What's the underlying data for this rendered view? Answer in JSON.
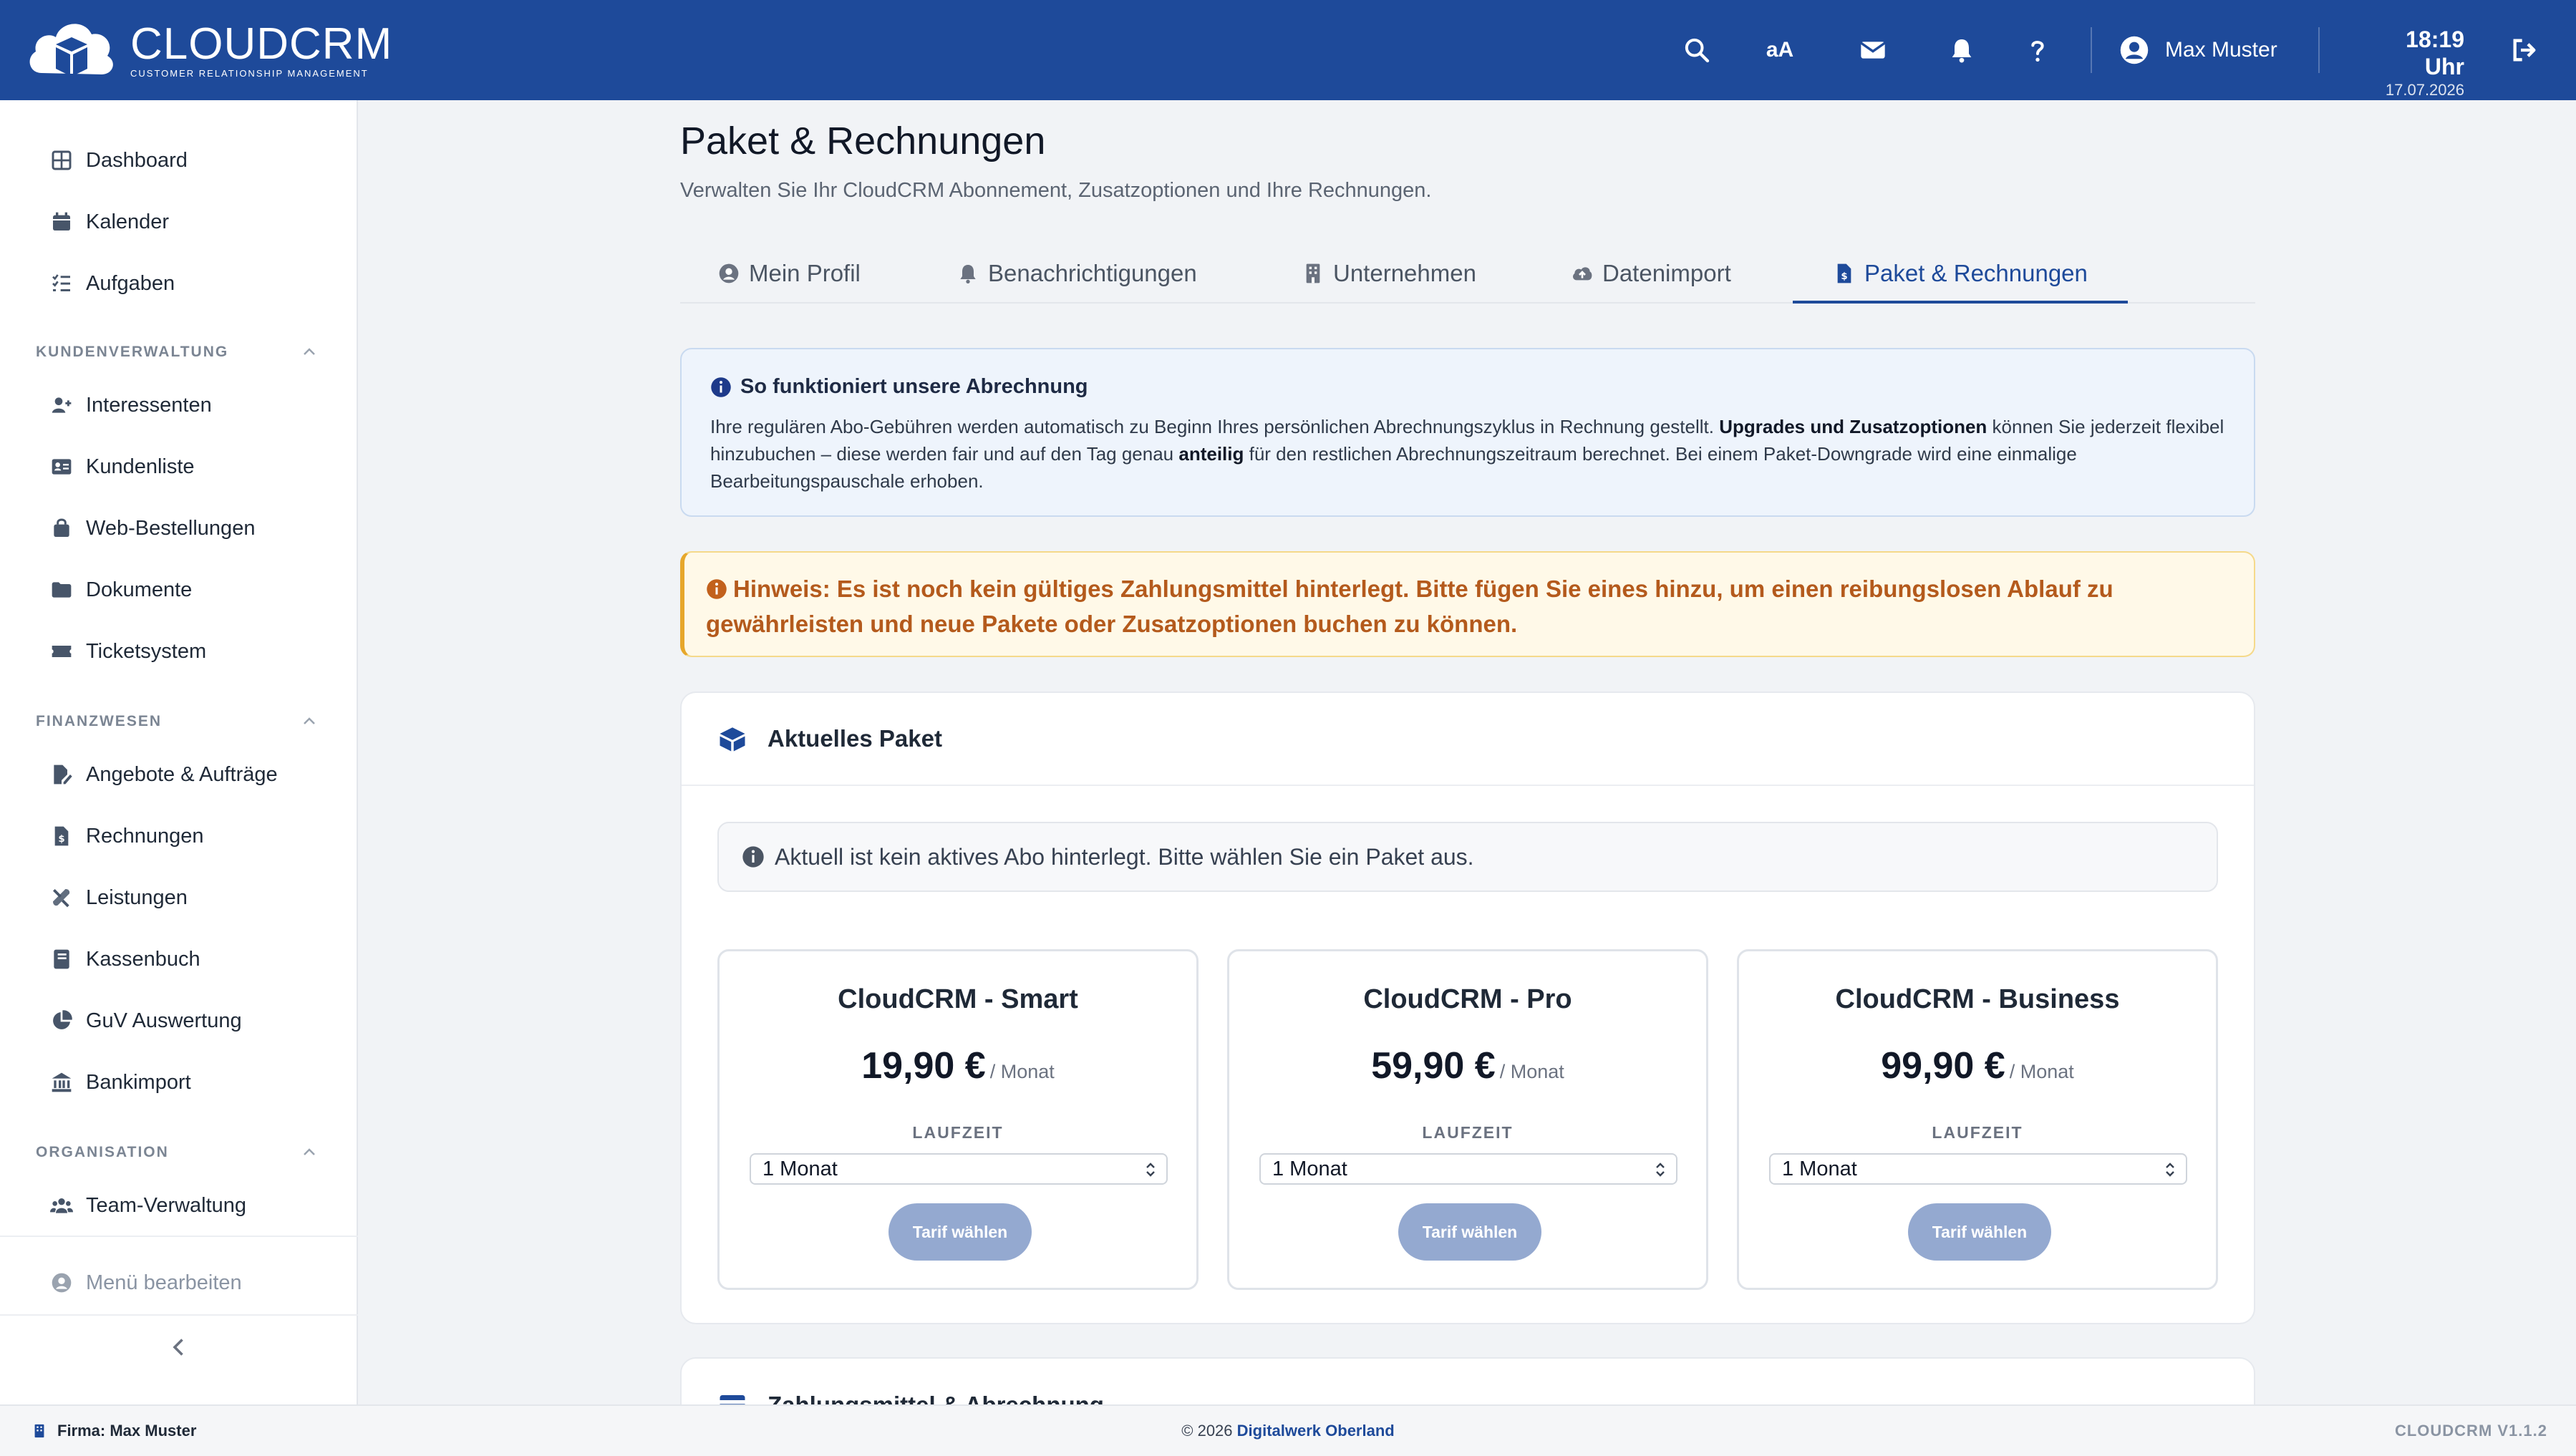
{
  "header": {
    "logo_title": "CLOUDCRM",
    "logo_subtitle": "CUSTOMER RELATIONSHIP MANAGEMENT",
    "font_toggle": "aA",
    "user_name": "Max Muster",
    "time": "18:19 Uhr",
    "date": "17.07.2026",
    "accent_color": "#1e4a9a"
  },
  "sidebar": {
    "top_items": [
      {
        "label": "Dashboard",
        "icon": "grid-icon"
      },
      {
        "label": "Kalender",
        "icon": "calendar-icon"
      },
      {
        "label": "Aufgaben",
        "icon": "tasks-icon"
      }
    ],
    "sections": [
      {
        "title": "KUNDENVERWALTUNG",
        "items": [
          {
            "label": "Interessenten",
            "icon": "user-plus-icon"
          },
          {
            "label": "Kundenliste",
            "icon": "address-card-icon"
          },
          {
            "label": "Web-Bestellungen",
            "icon": "shopping-bag-icon"
          },
          {
            "label": "Dokumente",
            "icon": "folder-icon"
          },
          {
            "label": "Ticketsystem",
            "icon": "ticket-icon"
          }
        ]
      },
      {
        "title": "FINANZWESEN",
        "items": [
          {
            "label": "Angebote & Aufträge",
            "icon": "file-signature-icon"
          },
          {
            "label": "Rechnungen",
            "icon": "invoice-icon"
          },
          {
            "label": "Leistungen",
            "icon": "tools-icon"
          },
          {
            "label": "Kassenbuch",
            "icon": "book-icon"
          },
          {
            "label": "GuV Auswertung",
            "icon": "pie-chart-icon"
          },
          {
            "label": "Bankimport",
            "icon": "bank-icon"
          }
        ]
      },
      {
        "title": "ORGANISATION",
        "items": [
          {
            "label": "Team-Verwaltung",
            "icon": "users-icon"
          }
        ]
      }
    ],
    "menu_edit": "Menü bearbeiten"
  },
  "page": {
    "title": "Paket & Rechnungen",
    "subtitle": "Verwalten Sie Ihr CloudCRM Abonnement, Zusatzoptionen und Ihre Rechnungen.",
    "tabs": [
      {
        "label": "Mein Profil",
        "icon": "user-circle-icon"
      },
      {
        "label": "Benachrichtigungen",
        "icon": "bell-icon"
      },
      {
        "label": "Unternehmen",
        "icon": "building-icon"
      },
      {
        "label": "Datenimport",
        "icon": "cloud-upload-icon"
      },
      {
        "label": "Paket & Rechnungen",
        "icon": "invoice-icon",
        "active": true
      }
    ]
  },
  "info": {
    "title": "So funktioniert unsere Abrechnung",
    "text_1": "Ihre regulären Abo-Gebühren werden automatisch zu Beginn Ihres persönlichen Abrechnungszyklus in Rechnung gestellt. ",
    "bold_1": "Upgrades und Zusatzoptionen",
    "text_2": " können Sie jederzeit flexibel hinzubuchen – diese werden fair und auf den Tag genau ",
    "bold_2": "anteilig",
    "text_3": " für den restlichen Abrechnungszeitraum berechnet. Bei einem Paket-Downgrade wird eine einmalige Bearbeitungspauschale erhoben."
  },
  "warning": {
    "text": "Hinweis: Es ist noch kein gültiges Zahlungsmittel hinterlegt. Bitte fügen Sie eines hinzu, um einen reibungslosen Ablauf zu gewährleisten und neue Pakete oder Zusatzoptionen buchen zu können."
  },
  "current_package": {
    "title": "Aktuelles Paket",
    "notice": "Aktuell ist kein aktives Abo hinterlegt. Bitte wählen Sie ein Paket aus.",
    "plans": [
      {
        "name": "CloudCRM - Smart",
        "price": "19,90 €",
        "period": "/ Monat",
        "term_label": "LAUFZEIT",
        "term": "1 Monat",
        "button": "Tarif wählen"
      },
      {
        "name": "CloudCRM - Pro",
        "price": "59,90 €",
        "period": "/ Monat",
        "term_label": "LAUFZEIT",
        "term": "1 Monat",
        "button": "Tarif wählen"
      },
      {
        "name": "CloudCRM - Business",
        "price": "99,90 €",
        "period": "/ Monat",
        "term_label": "LAUFZEIT",
        "term": "1 Monat",
        "button": "Tarif wählen"
      }
    ]
  },
  "payment": {
    "title": "Zahlungsmittel & Abrechnung"
  },
  "footer": {
    "company": "Firma: Max Muster",
    "copyright": "© 2026 ",
    "copyright_link": "Digitalwerk Oberland",
    "version": "CLOUDCRM V1.1.2"
  }
}
